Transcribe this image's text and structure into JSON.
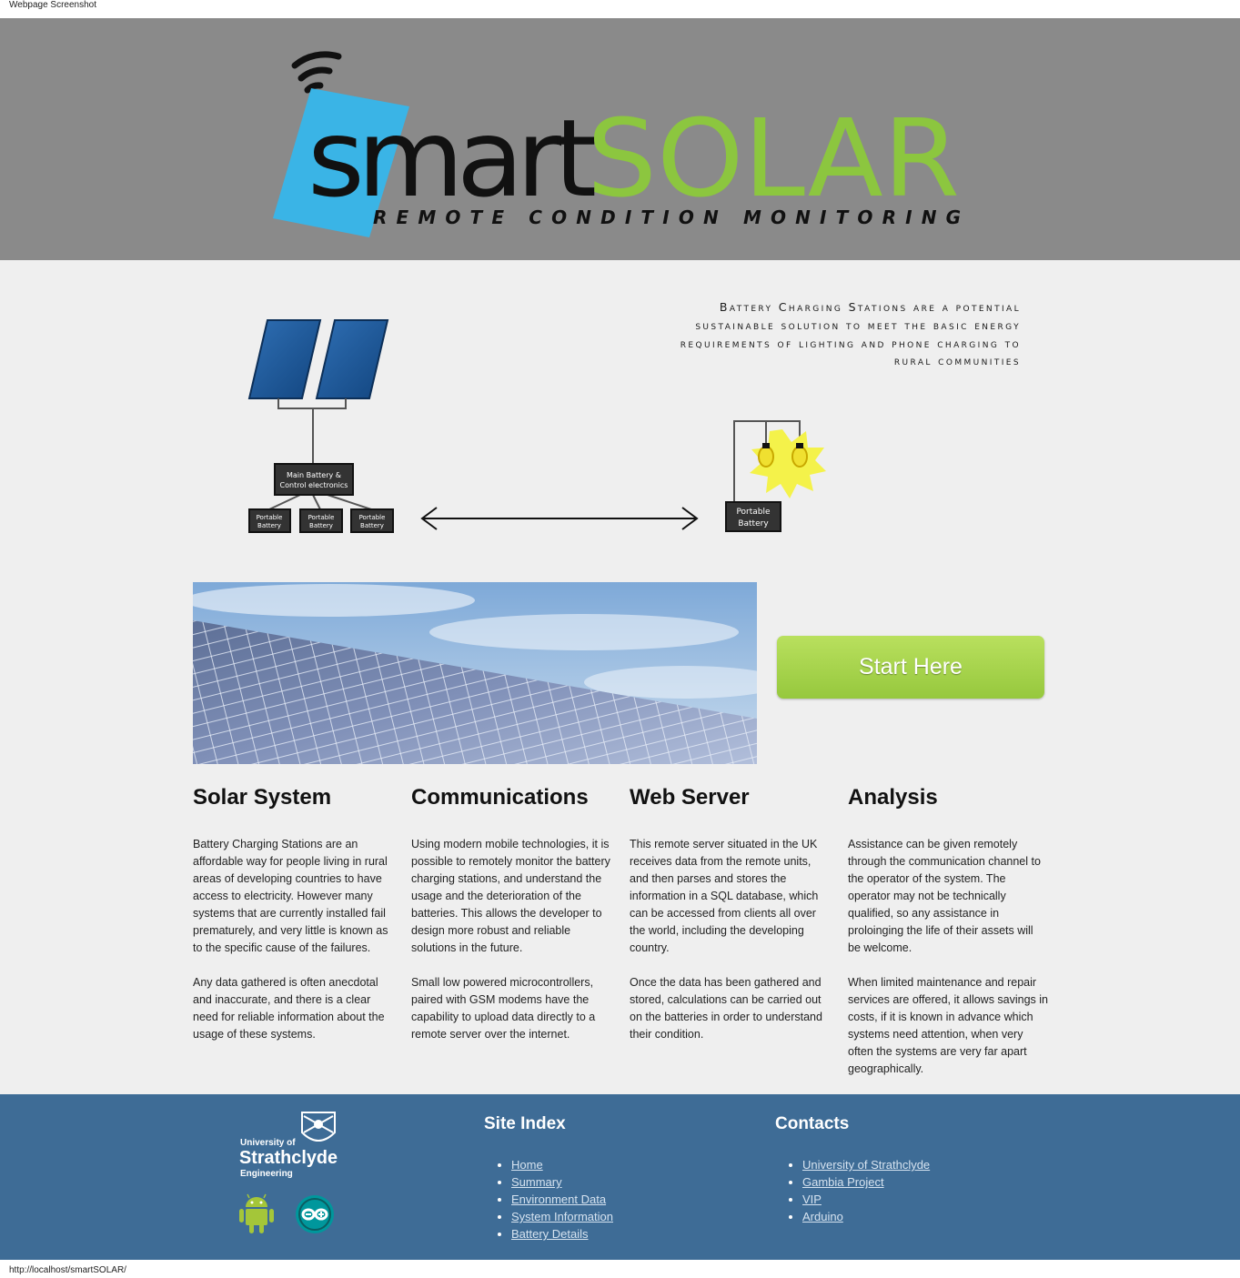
{
  "caption": "Webpage Screenshot",
  "logo": {
    "smart": "smart",
    "solar": "SOLAR",
    "subtitle": "REMOTE CONDITION MONITORING"
  },
  "tagline": [
    "Battery Charging Stations are a potential",
    "sustainable solution  to meet the basic energy",
    "requirements of lighting  and phone charging to",
    "rural communities"
  ],
  "diagram": {
    "main_battery": [
      "Main Battery &",
      "Control electronics"
    ],
    "portable": [
      "Portable",
      "Battery"
    ]
  },
  "start_button": "Start Here",
  "columns": [
    {
      "title": "Solar System",
      "paragraphs": [
        "Battery Charging Stations are an affordable way for people living in rural areas of developing countries to have access to electricity.  However many systems that are currently installed fail prematurely, and very little is known as to the specific cause of the failures.",
        "Any data gathered is often anecdotal and inaccurate, and there is a clear need for reliable information about the usage of these systems."
      ]
    },
    {
      "title": "Communications",
      "paragraphs": [
        "Using modern mobile technologies, it is possible to remotely monitor the battery charging stations, and understand the usage and the deterioration of the batteries.  This allows the developer to design more robust and reliable solutions in the future.",
        "Small low powered microcontrollers, paired with GSM modems have the capability to upload data directly to a remote server over the internet."
      ]
    },
    {
      "title": "Web Server",
      "paragraphs": [
        "This remote server situated in the UK receives data from the remote units, and then parses and stores the information in a SQL database, which can be accessed from clients all over the world, including the developing country.",
        "Once the data has been gathered and stored, calculations can be carried out on the batteries in order to understand their condition."
      ]
    },
    {
      "title": "Analysis",
      "paragraphs": [
        "Assistance can be given remotely through the communication channel to the operator of the system.  The operator may not be technically qualified, so any assistance in proloinging the life of their assets will be welcome.",
        "When limited maintenance and repair services are offered, it allows savings in costs, if it is known in advance which systems need attention, when very often the systems are very far apart geographically."
      ]
    }
  ],
  "footer": {
    "uni": {
      "line1": "University of",
      "line2": "Strathclyde",
      "line3": "Engineering"
    },
    "site_index": {
      "title": "Site Index",
      "links": [
        "Home",
        "Summary",
        "Environment Data",
        "System Information",
        "Battery Details"
      ]
    },
    "contacts": {
      "title": "Contacts",
      "links": [
        "University of Strathclyde",
        "Gambia Project",
        "VIP",
        "Arduino"
      ]
    }
  },
  "status_url": "http://localhost/smartSOLAR/",
  "colors": {
    "header_bg": "#8a8a8a",
    "solar_green": "#8cc63f",
    "panel_blue": "#3ab4e6",
    "footer_bg": "#3e6c96",
    "button_green": "#a5d14a"
  }
}
